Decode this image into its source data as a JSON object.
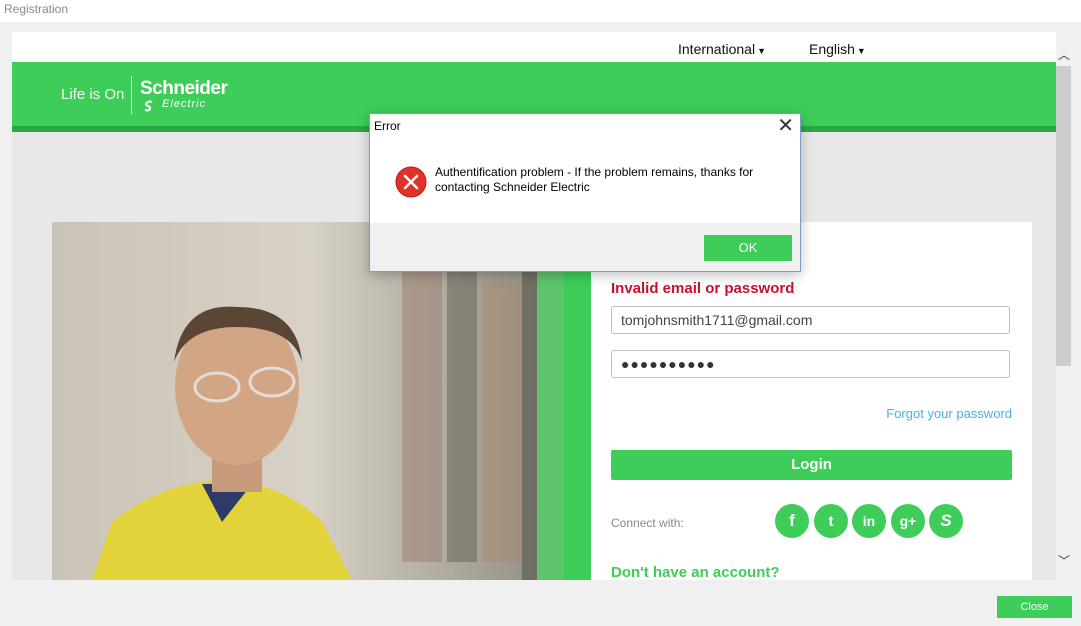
{
  "window": {
    "title": "Registration",
    "close_label": "Close"
  },
  "topbar": {
    "region_label": "International",
    "language_label": "English"
  },
  "header": {
    "tagline": "Life is On",
    "brand_name": "Schneider",
    "brand_sub": "Electric"
  },
  "login": {
    "error_text": "Invalid email or password",
    "email_value": "tomjohnsmith1711@gmail.com",
    "password_value": "●●●●●●●●●●",
    "forgot_label": "Forgot your password",
    "login_label": "Login",
    "connect_label": "Connect with:",
    "social": [
      {
        "name": "facebook-icon",
        "glyph": "f"
      },
      {
        "name": "twitter-icon",
        "glyph": "t"
      },
      {
        "name": "linkedin-icon",
        "glyph": "in"
      },
      {
        "name": "googleplus-icon",
        "glyph": "g+"
      },
      {
        "name": "schneider-icon",
        "glyph": "S"
      }
    ],
    "no_account_label": "Don't have an account?"
  },
  "dialog": {
    "title": "Error",
    "message": "Authentification problem - If the problem remains, thanks for contacting Schneider Electric",
    "ok_label": "OK"
  },
  "colors": {
    "brand_green": "#3dcd58",
    "error_red": "#c8102e",
    "link_blue": "#42b4e6"
  }
}
